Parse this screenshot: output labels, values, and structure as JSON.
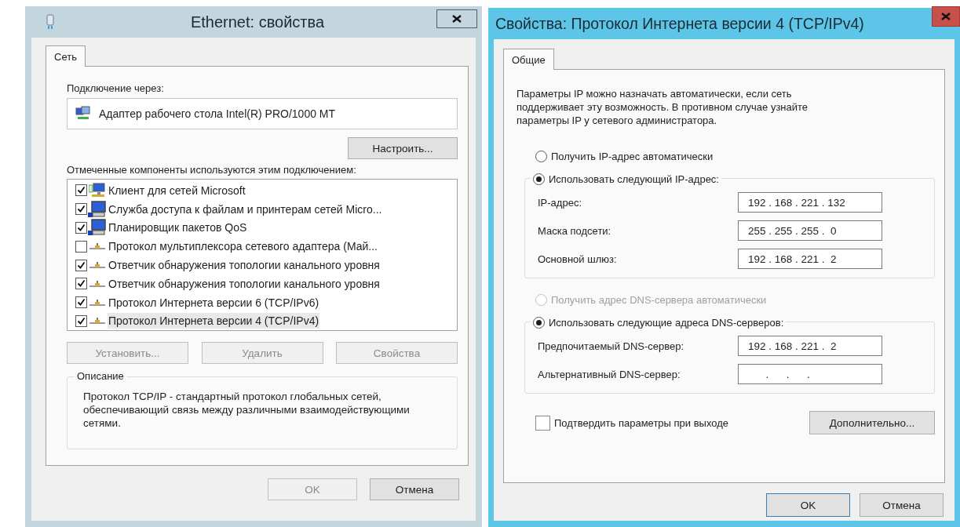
{
  "ethernet_window": {
    "title": "Ethernet: свойства",
    "tabs": [
      {
        "label": "Сеть",
        "selected": true
      }
    ],
    "connect_label": "Подключение через:",
    "adapter": "Адаптер рабочего стола Intel(R) PRO/1000 MT",
    "configure_button": "Настроить...",
    "components_label": "Отмеченные компоненты используются этим подключением:",
    "components": [
      {
        "kind": "client",
        "label": "Клиент для сетей Microsoft",
        "checked": true,
        "selected": false
      },
      {
        "kind": "service",
        "label": "Служба доступа к файлам и принтерам сетей Micro...",
        "checked": true,
        "selected": false
      },
      {
        "kind": "service",
        "label": "Планировщик пакетов QoS",
        "checked": true,
        "selected": false
      },
      {
        "kind": "protocol",
        "label": "Протокол мультиплексора сетевого адаптера (Май...",
        "checked": false,
        "selected": false
      },
      {
        "kind": "protocol",
        "label": "Ответчик обнаружения топологии канального уровня",
        "checked": true,
        "selected": false
      },
      {
        "kind": "protocol",
        "label": "Ответчик обнаружения топологии канального уровня",
        "checked": true,
        "selected": false
      },
      {
        "kind": "protocol",
        "label": "Протокол Интернета версии 6 (TCP/IPv6)",
        "checked": true,
        "selected": false
      },
      {
        "kind": "protocol",
        "label": "Протокол Интернета версии 4 (TCP/IPv4)",
        "checked": true,
        "selected": true
      }
    ],
    "component_buttons": [
      {
        "label": "Установить...",
        "disabled": true
      },
      {
        "label": "Удалить",
        "disabled": true
      },
      {
        "label": "Свойства",
        "disabled": true
      }
    ],
    "description": {
      "legend": "Описание",
      "text": "Протокол TCP/IP - стандартный протокол глобальных сетей, обеспечивающий связь между различными взаимодействующими сетями."
    },
    "footer_buttons": [
      {
        "label": "OK",
        "disabled": true
      },
      {
        "label": "Отмена",
        "disabled": false
      }
    ]
  },
  "ipv4_window": {
    "title": "Свойства: Протокол Интернета версии 4 (TCP/IPv4)",
    "tabs": [
      {
        "label": "Общие",
        "selected": true
      }
    ],
    "intro": "Параметры IP можно назначать автоматически, если сеть поддерживает эту возможность. В противном случае узнайте параметры IP у сетевого администратора.",
    "ip_options": [
      {
        "label": "Получить IP-адрес автоматически",
        "selected": false,
        "disabled": false
      },
      {
        "label": "Использовать следующий IP-адрес:",
        "selected": true,
        "disabled": false
      }
    ],
    "ip_fields": [
      {
        "label": "IP-адрес:",
        "value": "192 . 168 . 221 . 132"
      },
      {
        "label": "Маска подсети:",
        "value": "255 . 255 . 255 .  0"
      },
      {
        "label": "Основной шлюз:",
        "value": "192 . 168 . 221 .  2"
      }
    ],
    "dns_options": [
      {
        "label": "Получить адрес DNS-сервера автоматически",
        "selected": false,
        "disabled": true
      },
      {
        "label": "Использовать следующие адреса DNS-серверов:",
        "selected": true,
        "disabled": false
      }
    ],
    "dns_fields": [
      {
        "label": "Предпочитаемый DNS-сервер:",
        "value": "192 . 168 . 221 .  2"
      },
      {
        "label": "Альтернативный DNS-сервер:",
        "value": "      .      .      ."
      }
    ],
    "confirm": {
      "label": "Подтвердить параметры при выходе",
      "checked": false
    },
    "advanced_button": "Дополнительно...",
    "footer_buttons": [
      {
        "label": "OK",
        "default": true
      },
      {
        "label": "Отмена",
        "default": false
      }
    ]
  }
}
